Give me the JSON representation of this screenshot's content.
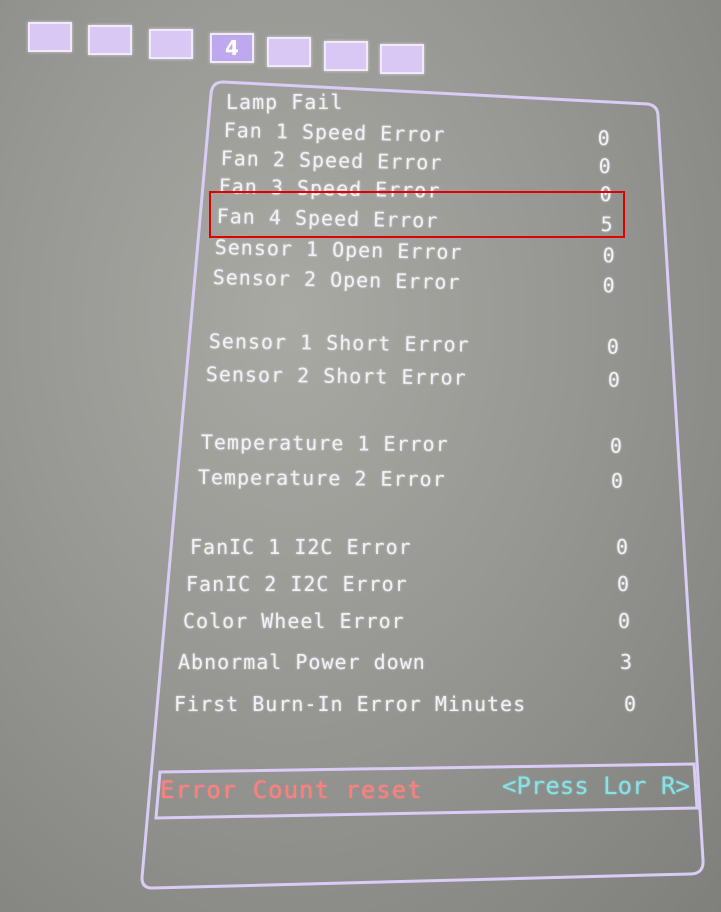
{
  "tabs": [
    "",
    "",
    "",
    "4",
    "",
    "",
    ""
  ],
  "active_tab_index": 3,
  "errors": [
    {
      "label": "Lamp Fail",
      "value": ""
    },
    {
      "label": "Fan 1 Speed Error",
      "value": "0"
    },
    {
      "label": "Fan 2 Speed Error",
      "value": "0"
    },
    {
      "label": "Fan 3 Speed Error",
      "value": "0"
    },
    {
      "label": "Fan 4 Speed Error",
      "value": "5"
    },
    {
      "label": "Sensor 1 Open Error",
      "value": "0"
    },
    {
      "label": "Sensor 2 Open Error",
      "value": "0"
    },
    {
      "label": "Sensor 1 Short Error",
      "value": "0"
    },
    {
      "label": "Sensor 2 Short Error",
      "value": "0"
    },
    {
      "label": "Temperature 1 Error",
      "value": "0"
    },
    {
      "label": "Temperature 2 Error",
      "value": "0"
    },
    {
      "label": "FanIC 1 I2C Error",
      "value": "0"
    },
    {
      "label": "FanIC 2 I2C Error",
      "value": "0"
    },
    {
      "label": "Color Wheel Error",
      "value": "0"
    },
    {
      "label": "Abnormal Power down",
      "value": "3"
    },
    {
      "label": "First Burn-In Error Minutes",
      "value": "0"
    }
  ],
  "reset": {
    "label": "Error Count reset",
    "hint": "<Press Lor R>"
  },
  "colors": {
    "frame": "#d9cdf6",
    "text": "#f3f1f8",
    "reset_label": "#ff7f7f",
    "reset_hint": "#86e4e9",
    "highlight": "#e00000",
    "tab_fill": "#d8c8f3"
  }
}
